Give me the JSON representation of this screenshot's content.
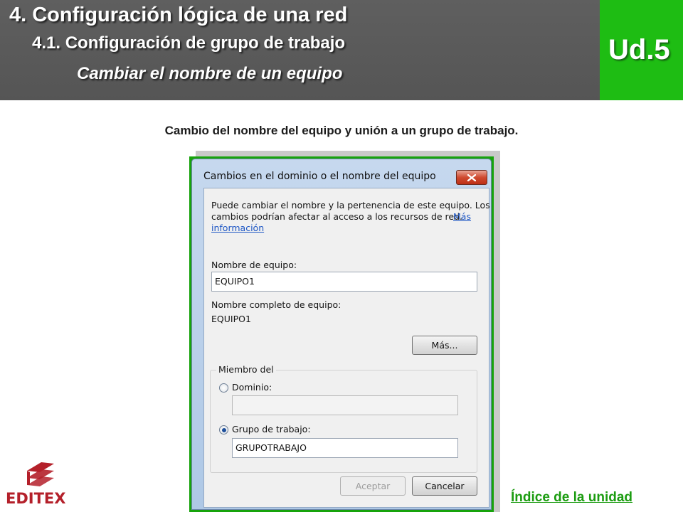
{
  "header": {
    "title": "4. Configuración lógica de una red",
    "subtitle": "4.1. Configuración de grupo de trabajo",
    "section": "Cambiar el nombre de un equipo",
    "unit": "Ud.5"
  },
  "caption": "Cambio del nombre del equipo y unión a un grupo de trabajo.",
  "dialog": {
    "title": "Cambios en el dominio o el nombre del equipo",
    "intro_line1": "Puede cambiar el nombre y la pertenencia de este equipo. Los",
    "intro_line2": "cambios podrían afectar al acceso a los recursos de red.",
    "more_info_link_part1": "Más",
    "more_info_link_part2": "información",
    "computer_name_label": "Nombre de equipo:",
    "computer_name_value": "EQUIPO1",
    "full_name_label": "Nombre completo de equipo:",
    "full_name_value": "EQUIPO1",
    "more_button": "Más...",
    "member_of_label": "Miembro del",
    "domain_label": "Dominio:",
    "domain_value": "",
    "workgroup_label": "Grupo de trabajo:",
    "workgroup_value": "GRUPOTRABAJO",
    "selected_option": "workgroup",
    "ok_button": "Aceptar",
    "cancel_button": "Cancelar"
  },
  "footer": {
    "logo_text": "EDITEX",
    "index_link": "Índice de la unidad"
  },
  "colors": {
    "header_bg": "#5a5a5a",
    "accent_green": "#1ebd13",
    "logo_red": "#b4202a",
    "link_green": "#1b9c10"
  }
}
